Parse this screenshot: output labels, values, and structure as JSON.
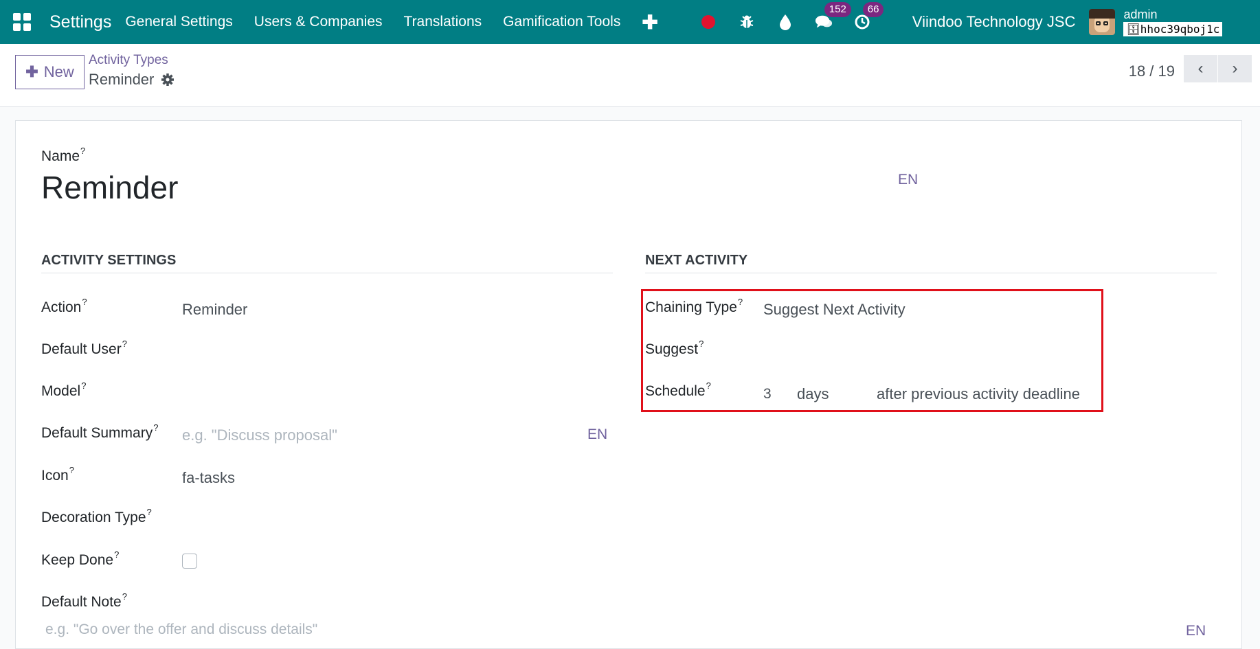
{
  "navbar": {
    "brand": "Settings",
    "menu": [
      "General Settings",
      "Users & Companies",
      "Translations",
      "Gamification Tools"
    ],
    "plus_icon": "plus-icon",
    "messages_badge": "152",
    "activities_badge": "66",
    "company": "Viindoo Technology JSC",
    "user": "admin",
    "database": "hhoc39qboj1c",
    "accent": "#017e84"
  },
  "control": {
    "new_label": "New",
    "breadcrumb_parent": "Activity Types",
    "breadcrumb_current": "Reminder",
    "pager": "18 / 19"
  },
  "form": {
    "name_label": "Name",
    "name_value": "Reminder",
    "lang": "EN",
    "activity_settings_title": "ACTIVITY SETTINGS",
    "next_activity_title": "NEXT ACTIVITY",
    "action_label": "Action",
    "action_value": "Reminder",
    "default_user_label": "Default User",
    "model_label": "Model",
    "default_summary_label": "Default Summary",
    "default_summary_placeholder": "e.g. \"Discuss proposal\"",
    "icon_label": "Icon",
    "icon_value": "fa-tasks",
    "decoration_type_label": "Decoration Type",
    "keep_done_label": "Keep Done",
    "default_note_label": "Default Note",
    "default_note_placeholder": "e.g. \"Go over the offer and discuss details\"",
    "chaining_type_label": "Chaining Type",
    "chaining_type_value": "Suggest Next Activity",
    "suggest_label": "Suggest",
    "schedule_label": "Schedule",
    "schedule_value": "3",
    "schedule_unit": "days",
    "schedule_from": "after previous activity deadline",
    "help_marker": "?"
  }
}
